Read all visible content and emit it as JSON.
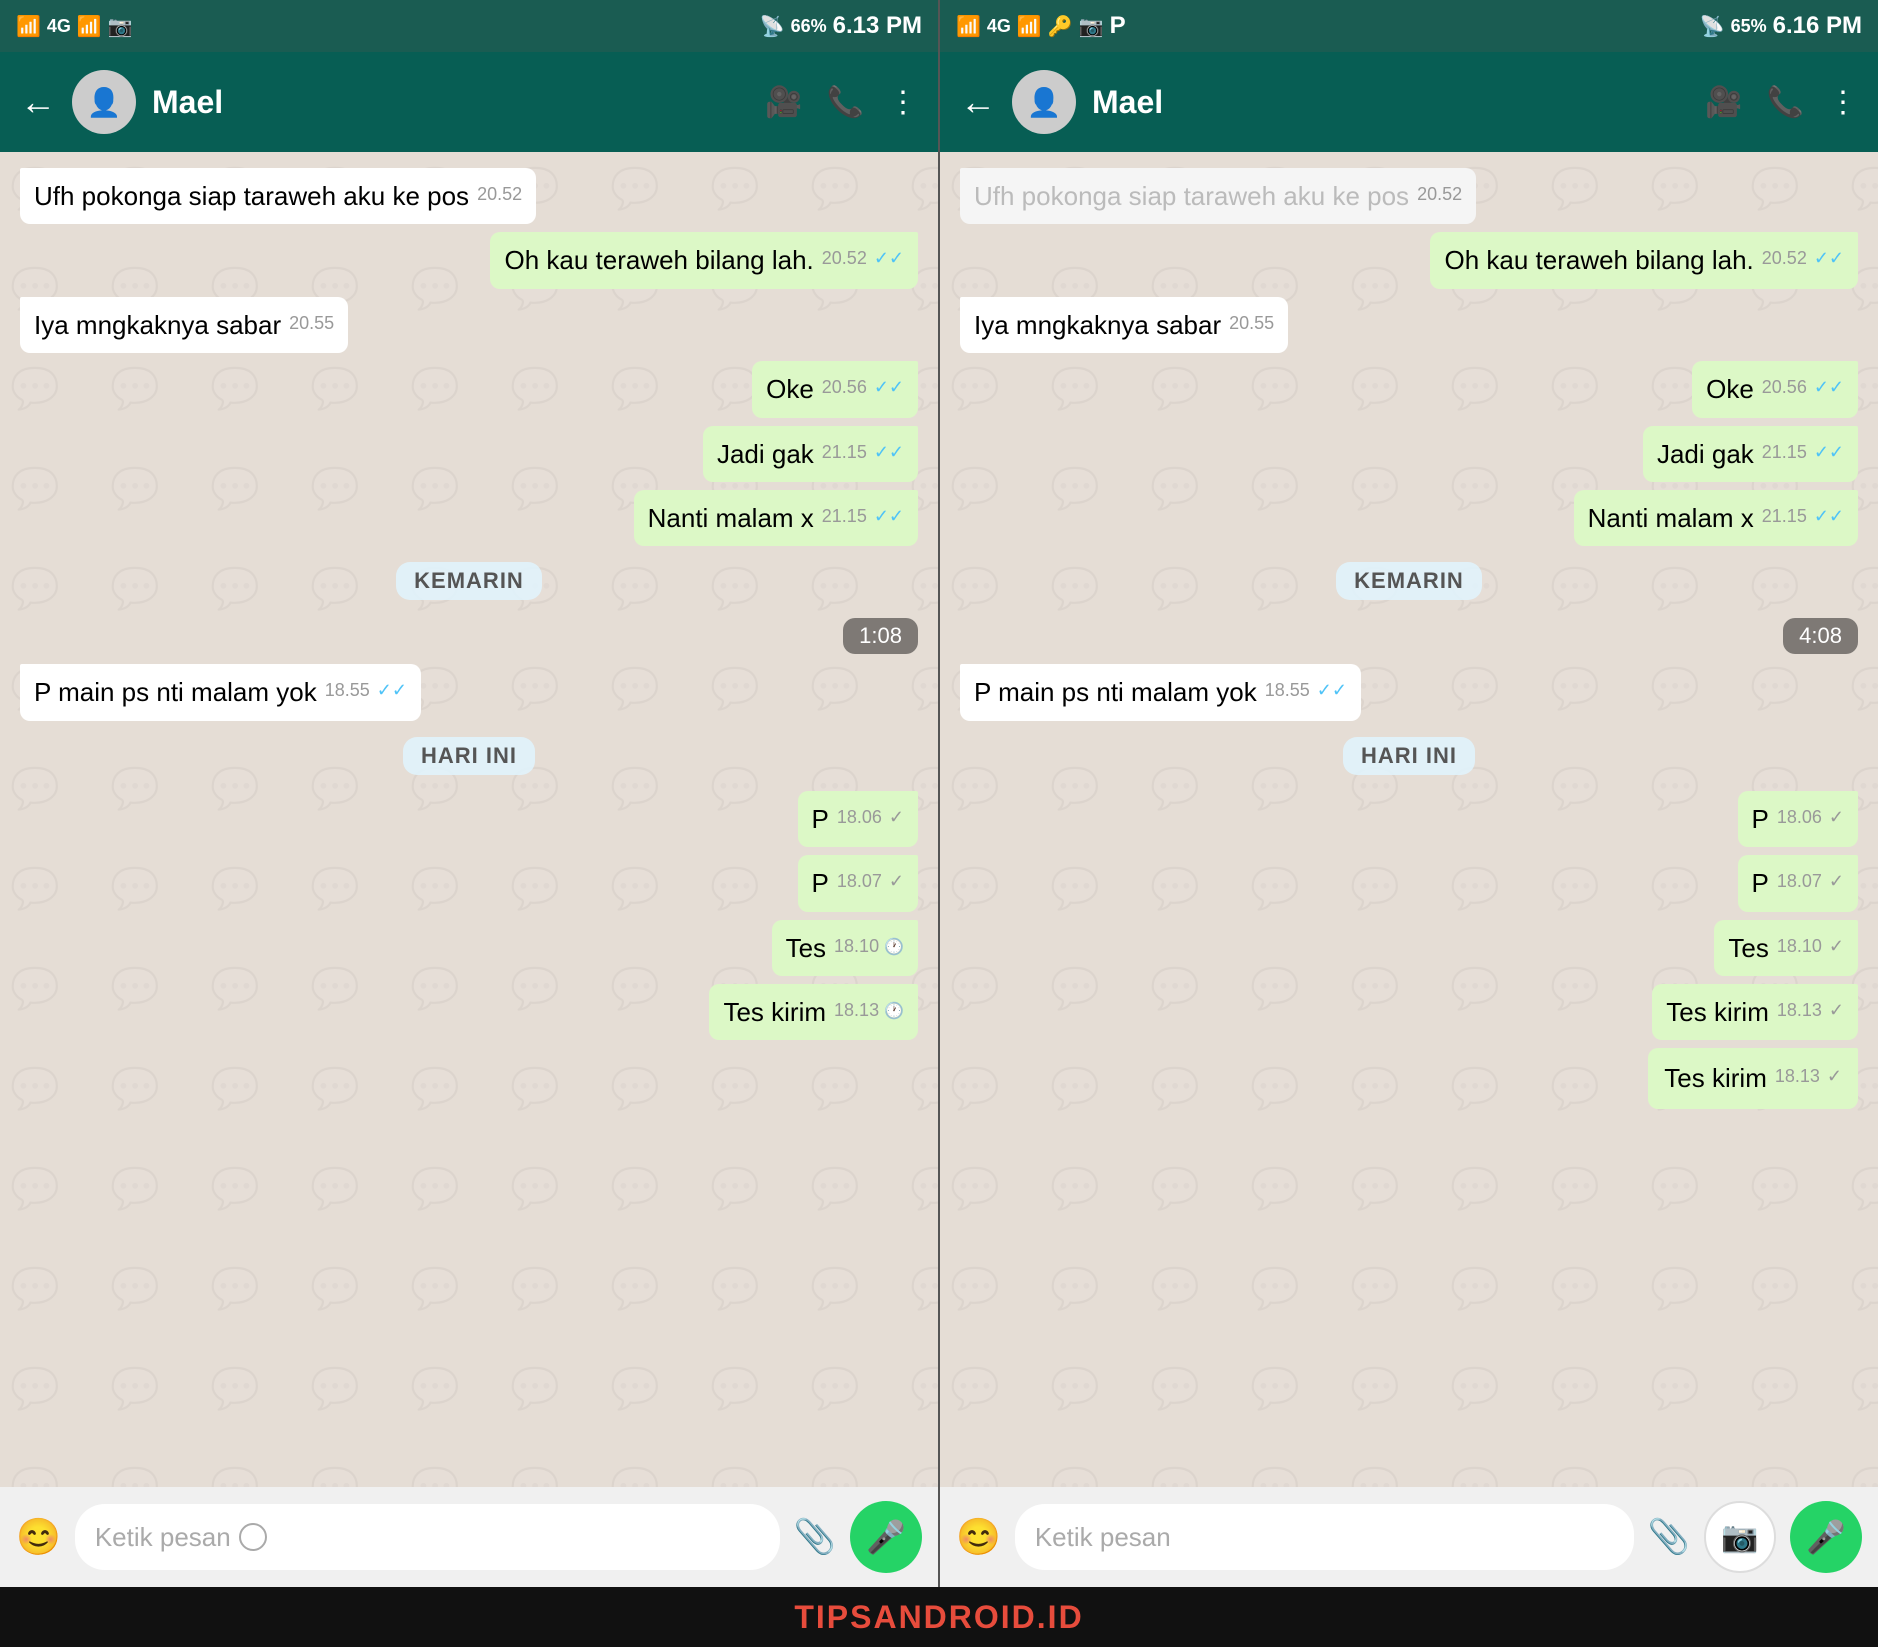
{
  "left_screen": {
    "status_bar": {
      "left": "📶 4G 📶",
      "time": "6.13 PM",
      "battery": "66%"
    },
    "header": {
      "contact": "Mael",
      "back": "←",
      "video_icon": "📹",
      "phone_icon": "📞",
      "menu_icon": "⋮"
    },
    "messages": [
      {
        "id": "m1",
        "type": "incoming",
        "text": "Ufh pokonga siap taraweh aku ke pos",
        "time": "20.52",
        "tick": ""
      },
      {
        "id": "m2",
        "type": "outgoing",
        "text": "Oh kau teraweh bilang lah.",
        "time": "20.52",
        "tick": "✓✓"
      },
      {
        "id": "m3",
        "type": "incoming",
        "text": "Iya mngkaknya sabar",
        "time": "20.55",
        "tick": ""
      },
      {
        "id": "m4",
        "type": "outgoing",
        "text": "Oke",
        "time": "20.56",
        "tick": "✓✓"
      },
      {
        "id": "m5",
        "type": "outgoing",
        "text": "Jadi gak",
        "time": "21.15",
        "tick": "✓✓"
      },
      {
        "id": "m6",
        "type": "outgoing",
        "text": "Nanti malam x",
        "time": "21.15",
        "tick": "✓✓"
      },
      {
        "id": "d1",
        "type": "day",
        "label": "KEMARIN"
      },
      {
        "id": "t1",
        "type": "time",
        "label": "1:08"
      },
      {
        "id": "m7",
        "type": "incoming",
        "text": "P main ps nti malam yok",
        "time": "18.55",
        "tick": "✓✓"
      },
      {
        "id": "d2",
        "type": "day",
        "label": "HARI INI"
      },
      {
        "id": "m8",
        "type": "outgoing",
        "text": "P",
        "time": "18.06",
        "tick": "✓"
      },
      {
        "id": "m9",
        "type": "outgoing",
        "text": "P",
        "time": "18.07",
        "tick": "✓"
      },
      {
        "id": "m10",
        "type": "outgoing",
        "text": "Tes",
        "time": "18.10",
        "tick": "⏱"
      },
      {
        "id": "m11",
        "type": "outgoing",
        "text": "Tes kirim",
        "time": "18.13",
        "tick": "⏱"
      }
    ],
    "input": {
      "placeholder": "Ketik pesan",
      "emoji": "😊",
      "attach": "📎"
    }
  },
  "right_screen": {
    "status_bar": {
      "left": "📶 4G 📶 🔑",
      "time": "6.16 PM",
      "battery": "65%"
    },
    "header": {
      "contact": "Mael",
      "back": "←",
      "video_icon": "📹",
      "phone_icon": "📞",
      "menu_icon": "⋮"
    },
    "messages": [
      {
        "id": "r0",
        "type": "incoming",
        "text": "Ufh pokonga siap taraweh aku ke pos",
        "time": "20.52",
        "tick": ""
      },
      {
        "id": "r1",
        "type": "outgoing",
        "text": "Oh kau teraweh bilang lah.",
        "time": "20.52",
        "tick": "✓✓"
      },
      {
        "id": "r2",
        "type": "incoming",
        "text": "Iya mngkaknya sabar",
        "time": "20.55",
        "tick": ""
      },
      {
        "id": "r3",
        "type": "outgoing",
        "text": "Oke",
        "time": "20.56",
        "tick": "✓✓"
      },
      {
        "id": "r4",
        "type": "outgoing",
        "text": "Jadi gak",
        "time": "21.15",
        "tick": "✓✓"
      },
      {
        "id": "r5",
        "type": "outgoing",
        "text": "Nanti malam x",
        "time": "21.15",
        "tick": "✓✓"
      },
      {
        "id": "rd1",
        "type": "day",
        "label": "KEMARIN"
      },
      {
        "id": "rt1",
        "type": "time",
        "label": "4:08"
      },
      {
        "id": "r6",
        "type": "incoming",
        "text": "P main ps nti malam yok",
        "time": "18.55",
        "tick": "✓✓"
      },
      {
        "id": "rd2",
        "type": "day",
        "label": "HARI INI"
      },
      {
        "id": "r7",
        "type": "outgoing",
        "text": "P",
        "time": "18.06",
        "tick": "✓"
      },
      {
        "id": "r8",
        "type": "outgoing",
        "text": "P",
        "time": "18.07",
        "tick": "✓"
      },
      {
        "id": "r9",
        "type": "outgoing",
        "text": "Tes",
        "time": "18.10",
        "tick": "✓"
      },
      {
        "id": "r10",
        "type": "outgoing",
        "text": "Tes kirim",
        "time": "18.13",
        "tick": "✓"
      },
      {
        "id": "r11",
        "type": "outgoing",
        "text": "Tes kirim",
        "time": "18.13",
        "tick": "✓"
      }
    ],
    "input": {
      "placeholder": "Ketik pesan",
      "emoji": "😊",
      "attach": "📎"
    }
  },
  "watermark": "TIPSANDROID.ID"
}
